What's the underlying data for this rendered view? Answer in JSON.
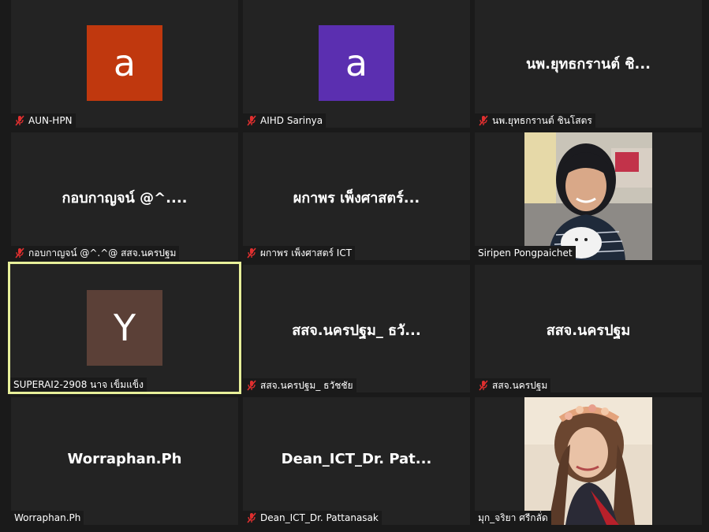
{
  "participants": [
    {
      "display": "a",
      "avatar_color": "#c0380e",
      "name": "AUN-HPN",
      "muted": true
    },
    {
      "display": "a",
      "avatar_color": "#5b2fb0",
      "name": "AIHD Sarinya",
      "muted": true
    },
    {
      "display": "นพ.ยุทธกรานต์ ชิ...",
      "name": "นพ.ยุทธกรานต์ ชินโสตร",
      "muted": true
    },
    {
      "display": "กอบกาญจน์ @^....",
      "name": "กอบกาญจน์ @^.^@ สสจ.นครปฐม",
      "muted": true
    },
    {
      "display": "ผกาพร เพ็งศาสตร์...",
      "name": "ผกาพร เพ็งศาสตร์ ICT",
      "muted": true
    },
    {
      "display": "photo",
      "name": "Siripen Pongpaichet",
      "muted": false
    },
    {
      "display": "Y",
      "avatar_color": "#5b4037",
      "name": "SUPERAI2-2908 นาจ เข็มแข็ง",
      "muted": false,
      "active_speaker": true
    },
    {
      "display": "สสจ.นครปฐม_ ธวั...",
      "name": "สสจ.นครปฐม_ ธวัชชัย",
      "muted": true
    },
    {
      "display": "สสจ.นครปฐม",
      "name": "สสจ.นครปฐม",
      "muted": true
    },
    {
      "display": "Worraphan.Ph",
      "name": "Worraphan.Ph",
      "muted": false
    },
    {
      "display": "Dean_ICT_Dr. Pat...",
      "name": "Dean_ICT_Dr. Pattanasak",
      "muted": true
    },
    {
      "display": "photo",
      "name": "มุก_จริยา ศรีกลั่ด",
      "muted": false
    }
  ],
  "icons": {
    "muted_mic": "mic-muted-icon"
  },
  "colors": {
    "tile_bg": "#232323",
    "page_bg": "#1a1a1a",
    "active_border": "#e8f09a",
    "mute_red": "#e02f2f"
  }
}
